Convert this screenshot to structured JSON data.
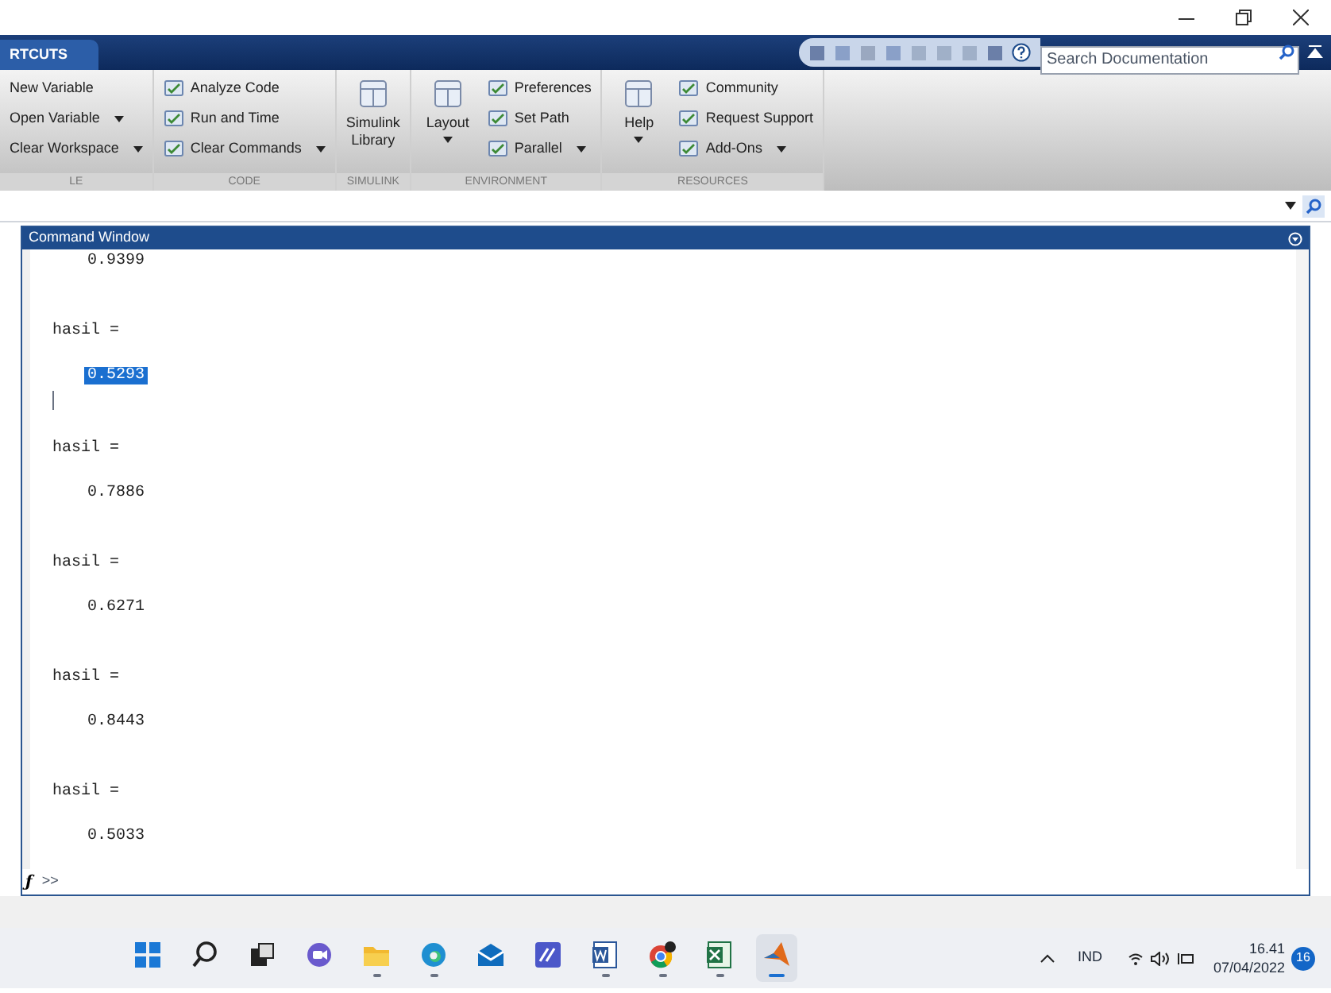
{
  "tabs": [
    {
      "label": "RTCUTS",
      "selected": true
    }
  ],
  "search": {
    "placeholder": "Search Documentation"
  },
  "ribbon": [
    {
      "label": "LE",
      "items": [
        {
          "kind": "small",
          "label": "New Variable",
          "dropdown": false
        },
        {
          "kind": "small",
          "label": "Open Variable",
          "dropdown": true
        },
        {
          "kind": "small",
          "label": "Clear Workspace",
          "dropdown": true
        }
      ]
    },
    {
      "label": "CODE",
      "items": [
        {
          "kind": "small",
          "label": "Analyze Code",
          "dropdown": false
        },
        {
          "kind": "small",
          "label": "Run and Time",
          "dropdown": false
        },
        {
          "kind": "small",
          "label": "Clear Commands",
          "dropdown": true
        }
      ]
    },
    {
      "label": "SIMULINK",
      "items": [
        {
          "kind": "large",
          "label": "Simulink Library",
          "dropdown": false
        }
      ]
    },
    {
      "label": "ENVIRONMENT",
      "items": [
        {
          "kind": "large",
          "label": "Layout",
          "dropdown": true
        },
        {
          "kind": "small",
          "label": "Preferences",
          "dropdown": false
        },
        {
          "kind": "small",
          "label": "Set Path",
          "dropdown": false
        },
        {
          "kind": "small",
          "label": "Parallel",
          "dropdown": true
        }
      ]
    },
    {
      "label": "RESOURCES",
      "items": [
        {
          "kind": "large",
          "label": "Help",
          "dropdown": true
        },
        {
          "kind": "small",
          "label": "Community",
          "dropdown": false
        },
        {
          "kind": "small",
          "label": "Request Support",
          "dropdown": false
        },
        {
          "kind": "small",
          "label": "Add-Ons",
          "dropdown": true
        }
      ]
    }
  ],
  "command_window": {
    "title": "Command Window",
    "lines": [
      {
        "kind": "value",
        "text": "0.9399",
        "selected": false
      },
      {
        "kind": "label",
        "text": "hasil ="
      },
      {
        "kind": "value",
        "text": "0.5293",
        "selected": true
      },
      {
        "kind": "cursor"
      },
      {
        "kind": "label",
        "text": "hasil ="
      },
      {
        "kind": "value",
        "text": "0.7886",
        "selected": false
      },
      {
        "kind": "label",
        "text": "hasil ="
      },
      {
        "kind": "value",
        "text": "0.6271",
        "selected": false
      },
      {
        "kind": "label",
        "text": "hasil ="
      },
      {
        "kind": "value",
        "text": "0.8443",
        "selected": false
      },
      {
        "kind": "label",
        "text": "hasil ="
      },
      {
        "kind": "value",
        "text": "0.5033",
        "selected": false
      }
    ],
    "function_button": "ƒ",
    "prompt": ">>"
  },
  "taskbar": {
    "apps": [
      {
        "kind": "start",
        "running": false,
        "selected": false
      },
      {
        "kind": "search",
        "running": false,
        "selected": false
      },
      {
        "kind": "taskview",
        "running": false,
        "selected": false
      },
      {
        "kind": "chat",
        "running": false,
        "selected": false
      },
      {
        "kind": "folder",
        "running": true,
        "selected": false
      },
      {
        "kind": "browser",
        "running": true,
        "selected": false
      },
      {
        "kind": "mail",
        "running": false,
        "selected": false
      },
      {
        "kind": "editor",
        "running": false,
        "selected": false
      },
      {
        "kind": "word",
        "running": true,
        "selected": false
      },
      {
        "kind": "chrome",
        "running": true,
        "selected": false
      },
      {
        "kind": "excel",
        "running": true,
        "selected": false
      },
      {
        "kind": "matlab",
        "running": true,
        "selected": true
      }
    ],
    "language": "IND",
    "time": "16.41",
    "date": "07/04/2022",
    "notifications": "16"
  }
}
